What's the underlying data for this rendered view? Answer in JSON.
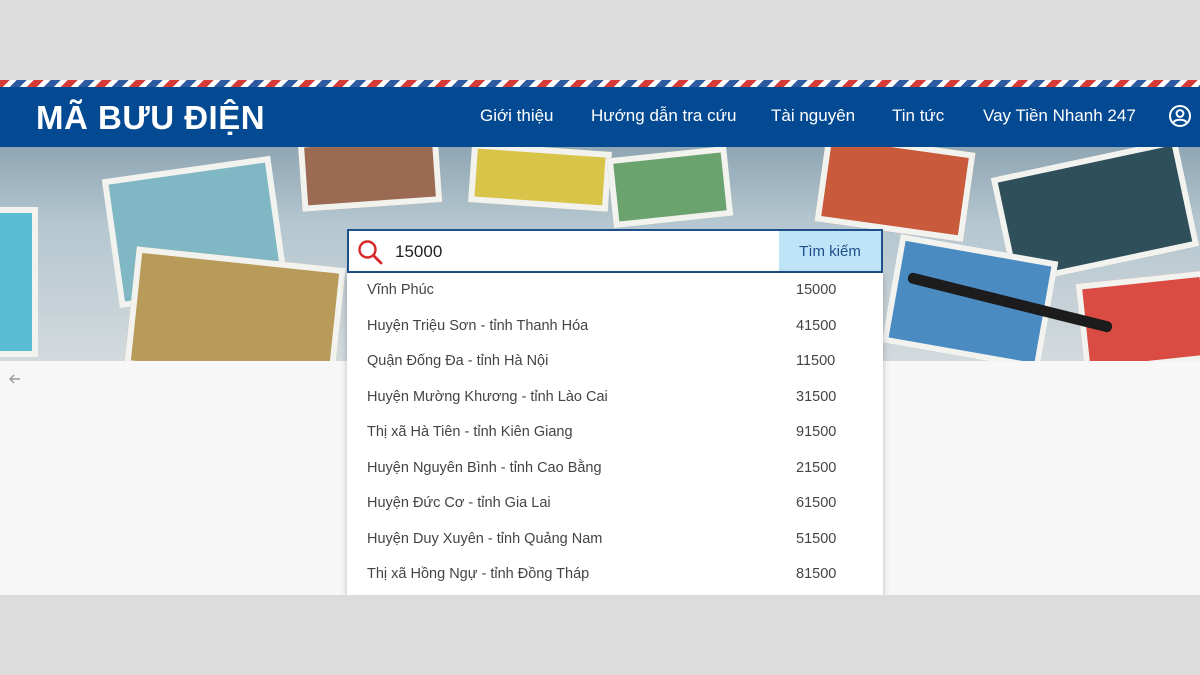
{
  "header": {
    "logo": "MÃ BƯU ĐIỆN",
    "nav": [
      "Giới thiệu",
      "Hướng dẫn tra cứu",
      "Tài nguyên",
      "Tin tức",
      "Vay Tiền Nhanh 247"
    ],
    "user_icon": "user-circle-icon"
  },
  "search": {
    "value": "15000",
    "button_label": "Tìm kiếm",
    "icon": "search-icon"
  },
  "results": [
    {
      "name": "Vĩnh Phúc",
      "code": "15000"
    },
    {
      "name": "Huyện Triệu Sơn - tỉnh Thanh Hóa",
      "code": "41500"
    },
    {
      "name": "Quận Đống Đa - tỉnh Hà Nội",
      "code": "11500"
    },
    {
      "name": "Huyện Mường Khương - tỉnh Lào Cai",
      "code": "31500"
    },
    {
      "name": "Thị xã Hà Tiên - tỉnh Kiên Giang",
      "code": "91500"
    },
    {
      "name": "Huyện Nguyên Bình - tỉnh Cao Bằng",
      "code": "21500"
    },
    {
      "name": "Huyện Đức Cơ - tỉnh Gia Lai",
      "code": "61500"
    },
    {
      "name": "Huyện Duy Xuyên - tỉnh Quảng Nam",
      "code": "51500"
    },
    {
      "name": "Thị xã Hồng Ngự - tỉnh Đồng Tháp",
      "code": "81500"
    }
  ],
  "colors": {
    "navbar": "#034a92",
    "search_button": "#bfe3f7",
    "search_icon": "#d62828"
  }
}
